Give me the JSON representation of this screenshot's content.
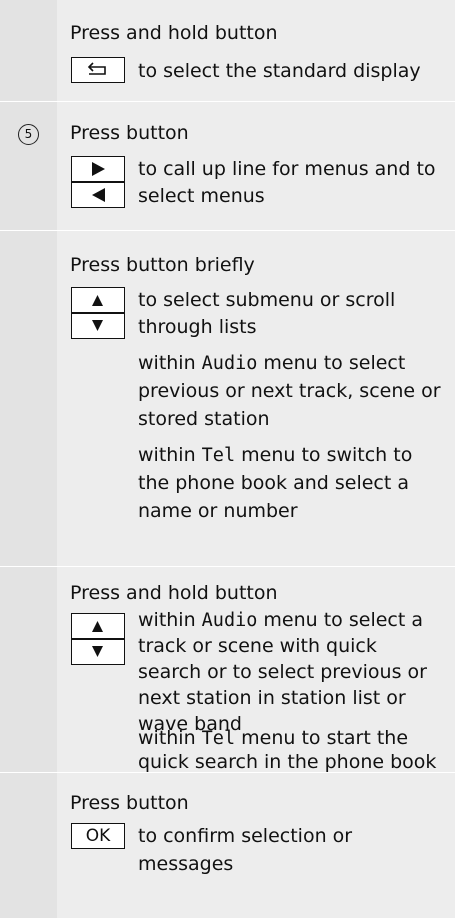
{
  "row1": {
    "instruction": "Press and hold button",
    "key_icon": "back-arrow-icon",
    "desc": "to select the standard display"
  },
  "row2": {
    "number": "5",
    "instruction": "Press button",
    "key_icons": [
      "right-arrow-icon",
      "left-arrow-icon"
    ],
    "desc": [
      "to call up line for menus and to",
      "select menus"
    ]
  },
  "row3": {
    "instruction": "Press button briefly",
    "key_icons": [
      "up-arrow-icon",
      "down-arrow-icon"
    ],
    "desc_lines": [
      "to select submenu or scroll",
      "through lists"
    ],
    "audio_menu": "Audio",
    "audio_a": " menu to select",
    "audio_b": "previous or next track, scene or",
    "audio_c": "stored station",
    "tel_menu": "Tel",
    "tel_a": " menu to switch to",
    "tel_b": "the phone book and select a",
    "tel_c": "name or number",
    "within": "within "
  },
  "row4": {
    "instruction": "Press and hold button",
    "key_icons": [
      "up-arrow-icon",
      "down-arrow-icon"
    ],
    "within": "within ",
    "audio_menu": "Audio",
    "audio_a": " menu to select a",
    "audio_b": "track or scene with quick",
    "audio_c": "search or to select previous or",
    "audio_d": "next station in station list or",
    "audio_e": "wave band",
    "tel_menu": "Tel",
    "tel_a": " menu to start the",
    "tel_b": "quick search in the phone book"
  },
  "row5": {
    "instruction": "Press button",
    "key_label": "OK",
    "desc": [
      "to confirm selection or",
      "messages"
    ]
  },
  "colors": {
    "background": "#ededed",
    "number_column": "#e3e3e3",
    "separator": "#ffffff",
    "key": "#ffffff"
  }
}
